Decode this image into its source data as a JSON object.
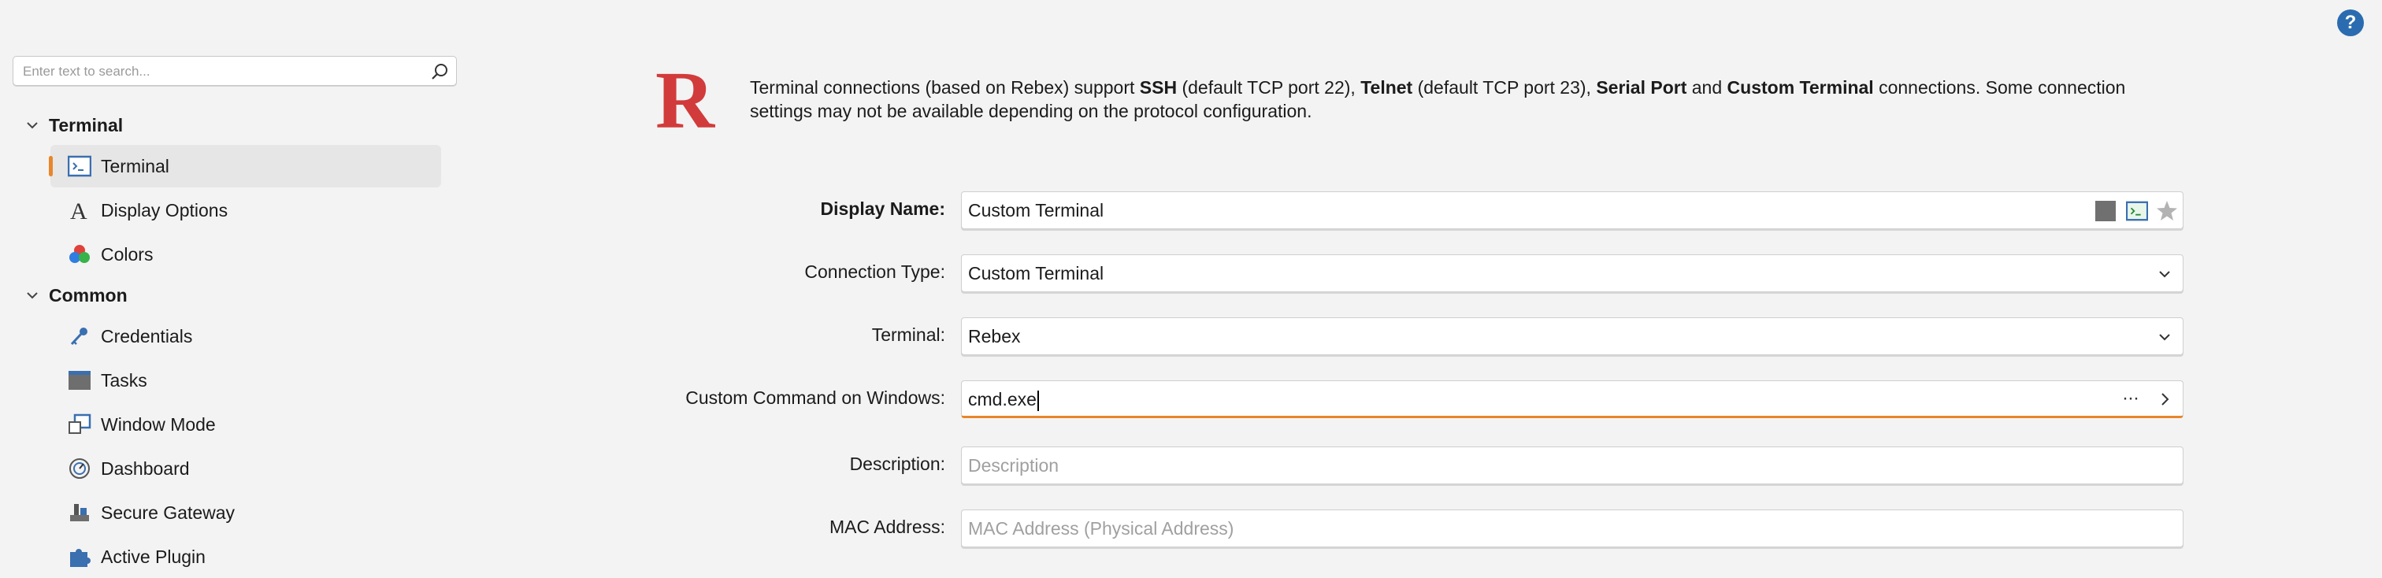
{
  "help": {
    "label": "?"
  },
  "search": {
    "placeholder": "Enter text to search..."
  },
  "sidebar": {
    "groups": [
      {
        "title": "Terminal"
      },
      {
        "title": "Common"
      }
    ],
    "items": [
      {
        "label": "Terminal",
        "icon": "terminal-icon",
        "selected": true
      },
      {
        "label": "Display Options",
        "icon": "font-a-icon"
      },
      {
        "label": "Colors",
        "icon": "color-palette-icon"
      },
      {
        "label": "Credentials",
        "icon": "key-icon"
      },
      {
        "label": "Tasks",
        "icon": "tasks-icon"
      },
      {
        "label": "Window Mode",
        "icon": "window-mode-icon"
      },
      {
        "label": "Dashboard",
        "icon": "dashboard-icon"
      },
      {
        "label": "Secure Gateway",
        "icon": "gateway-icon"
      },
      {
        "label": "Active Plugin",
        "icon": "plugin-puzzle-icon"
      }
    ],
    "accent_color": "#e8862a"
  },
  "info": {
    "logo_letter": "R",
    "logo_color": "#d23b3b",
    "p1": "Terminal connections (based on Rebex) support ",
    "ssh": "SSH",
    "p2": " (default TCP port 22), ",
    "telnet": "Telnet",
    "p3": " (default TCP port 23), ",
    "serial": "Serial Port",
    "p4": " and ",
    "custom": "Custom Terminal",
    "p5": " connections. Some connection settings may not be available depending on the protocol configuration."
  },
  "form": {
    "display_name": {
      "label": "Display Name:",
      "value": "Custom Terminal"
    },
    "connection_type": {
      "label": "Connection Type:",
      "value": "Custom Terminal"
    },
    "terminal": {
      "label": "Terminal:",
      "value": "Rebex"
    },
    "custom_command": {
      "label": "Custom Command on Windows:",
      "value": "cmd.exe",
      "more": "···"
    },
    "description": {
      "label": "Description:",
      "placeholder": "Description"
    },
    "mac_address": {
      "label": "MAC Address:",
      "placeholder": "MAC Address (Physical Address)"
    }
  }
}
